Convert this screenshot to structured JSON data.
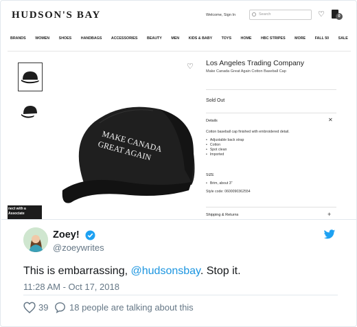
{
  "embedded_page": {
    "logo": "HUDSON'S BAY",
    "welcome": "Welcome, Sign In",
    "search_placeholder": "Search",
    "cart_count": "0",
    "nav": [
      "BRANDS",
      "WOMEN",
      "SHOES",
      "HANDBAGS",
      "ACCESSORIES",
      "BEAUTY",
      "MEN",
      "KIDS & BABY",
      "TOYS",
      "HOME",
      "HBC STRIPES",
      "MORE",
      "FALL 50",
      "SALE"
    ],
    "promo_text": [
      "nect with a",
      "Associate"
    ],
    "cap_text": [
      "MAKE CANADA",
      "GREAT AGAIN"
    ],
    "product": {
      "brand": "Los Angeles Trading Company",
      "name": "Make Canada Great Again Cotton Baseball Cap",
      "status": "Sold Out",
      "details_label": "Details",
      "description": "Cotton baseball cap finished with embroidered detail.",
      "features": [
        "Adjustable back strap",
        "Cotton",
        "Spot clean",
        "Imported"
      ],
      "size_label": "SIZE",
      "sizes": [
        "Brim, about 3\""
      ],
      "style_code": "Style code: 0600090362554",
      "shipping_label": "Shipping & Returns"
    }
  },
  "tweet": {
    "name": "Zoey!",
    "handle": "@zoeywrites",
    "text_before": "This is embarrassing, ",
    "mention": "@hudsonsbay",
    "text_after": ". Stop it.",
    "timestamp": "11:28 AM - Oct 17, 2018",
    "likes": "39",
    "talking": "18 people are talking about this",
    "colors": {
      "link": "#1b95e0",
      "muted": "#657786",
      "verified": "#1da1f2",
      "bird": "#1da1f2"
    }
  },
  "icons": [
    "search-icon",
    "heart-icon",
    "shopping-bag-icon",
    "close-icon",
    "plus-icon",
    "verified-badge-icon",
    "twitter-bird-icon",
    "like-heart-icon",
    "reply-bubble-icon"
  ]
}
